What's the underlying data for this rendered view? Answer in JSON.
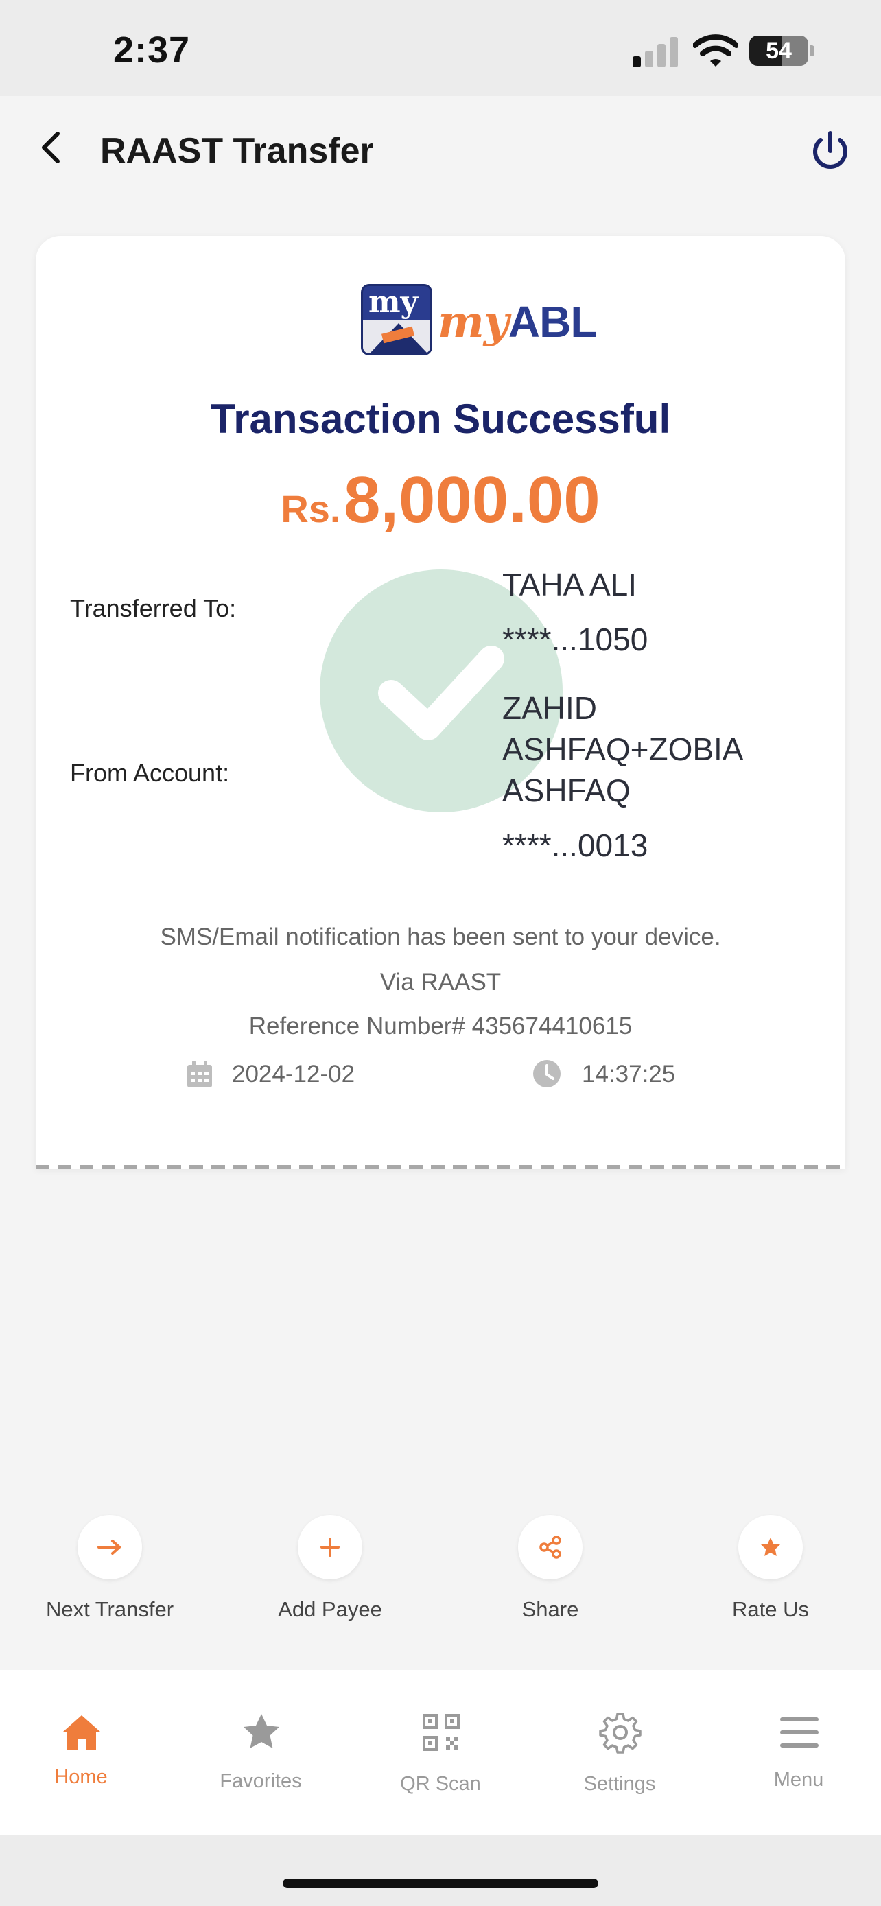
{
  "status_bar": {
    "time": "2:37",
    "battery": "54"
  },
  "header": {
    "title": "RAAST Transfer"
  },
  "logo": {
    "box_text": "my",
    "brand_my": "my",
    "brand_abl": "ABL"
  },
  "receipt": {
    "title": "Transaction Successful",
    "currency": "Rs.",
    "amount": "8,000.00",
    "transferred_to_label": "Transferred To:",
    "to_name": "TAHA ALI",
    "to_account": "****...1050",
    "from_account_label": "From Account:",
    "from_name_line1": "ZAHID",
    "from_name_line2": "ASHFAQ+ZOBIA",
    "from_name_line3": "ASHFAQ",
    "from_account": "****...0013",
    "notification": "SMS/Email notification has been sent to your device.",
    "via": "Via RAAST",
    "reference": "Reference Number# 435674410615",
    "date": "2024-12-02",
    "time": "14:37:25"
  },
  "actions": [
    {
      "label": "Next Transfer",
      "icon": "arrow-right-icon"
    },
    {
      "label": "Add Payee",
      "icon": "plus-icon"
    },
    {
      "label": "Share",
      "icon": "share-icon"
    },
    {
      "label": "Rate Us",
      "icon": "star-icon"
    }
  ],
  "nav": [
    {
      "label": "Home",
      "icon": "home-icon",
      "active": true
    },
    {
      "label": "Favorites",
      "icon": "star-icon"
    },
    {
      "label": "QR Scan",
      "icon": "qr-icon"
    },
    {
      "label": "Settings",
      "icon": "gear-icon"
    },
    {
      "label": "Menu",
      "icon": "hamburger-icon"
    }
  ],
  "colors": {
    "accent": "#ef7d3c",
    "navy": "#1b2468",
    "success_circle": "#d3e8dc"
  }
}
